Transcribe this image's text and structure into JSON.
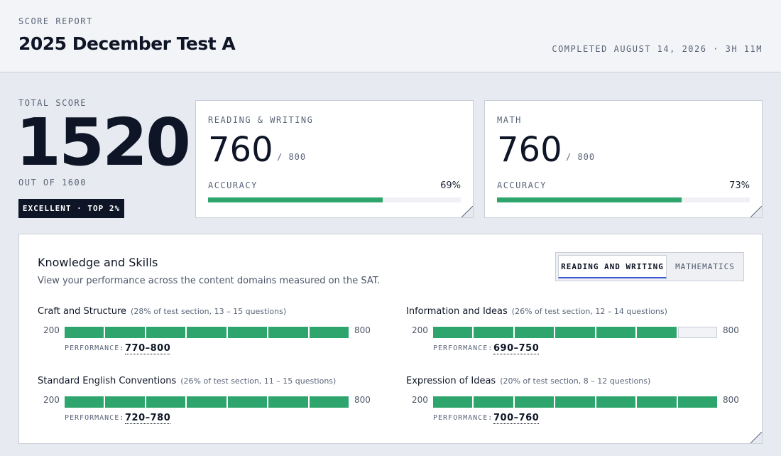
{
  "header": {
    "eyebrow": "SCORE REPORT",
    "title": "2025 December Test A",
    "completed": "COMPLETED AUGUST 14, 2026 · 3H 11M"
  },
  "total": {
    "label": "TOTAL SCORE",
    "score": "1520",
    "out_of": "OUT OF 1600",
    "badge": "EXCELLENT · TOP 2%"
  },
  "sections": [
    {
      "label": "READING & WRITING",
      "score": "760",
      "max": "/ 800",
      "accuracy_label": "ACCURACY",
      "accuracy": "69%",
      "accuracy_value": 0.69
    },
    {
      "label": "MATH",
      "score": "760",
      "max": "/ 800",
      "accuracy_label": "ACCURACY",
      "accuracy": "73%",
      "accuracy_value": 0.73
    }
  ],
  "knowledge": {
    "title": "Knowledge and Skills",
    "subtitle": "View your performance across the content domains measured on the SAT.",
    "tabs": [
      "READING AND WRITING",
      "MATHEMATICS"
    ],
    "active_tab": "READING AND WRITING",
    "perf_label": "PERFORMANCE:",
    "scale_min": "200",
    "scale_max": "800",
    "domains": [
      {
        "name": "Craft and Structure",
        "meta": "(28% of test section, 13 – 15 questions)",
        "performance": "770–800",
        "filled": 7,
        "segments": 7
      },
      {
        "name": "Information and Ideas",
        "meta": "(26% of test section, 12 – 14 questions)",
        "performance": "690–750",
        "filled": 6,
        "segments": 7
      },
      {
        "name": "Standard English Conventions",
        "meta": "(26% of test section, 11 – 15 questions)",
        "performance": "720–780",
        "filled": 7,
        "segments": 7
      },
      {
        "name": "Expression of Ideas",
        "meta": "(20% of test section, 8 – 12 questions)",
        "performance": "700–760",
        "filled": 7,
        "segments": 7
      }
    ]
  },
  "colors": {
    "accent_green": "#2fa56e",
    "tab_active_underline": "#3b57d6",
    "dark": "#0e1526"
  }
}
